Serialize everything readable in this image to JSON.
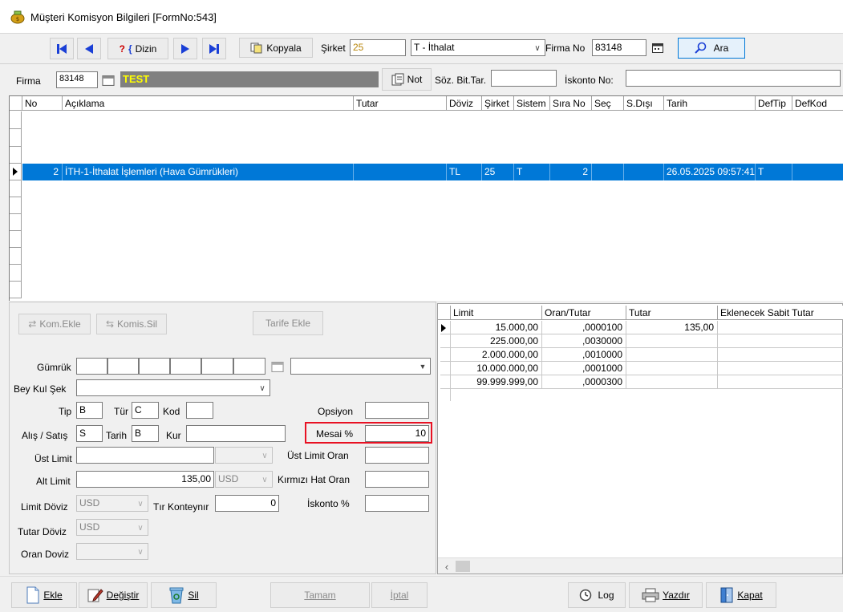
{
  "window": {
    "title": "Müşteri Komisyon Bilgileri [FormNo:543]"
  },
  "toolbar": {
    "dizin_label": "Dizin",
    "kopyala_label": "Kopyala",
    "sirket_label": "Şirket",
    "sirket_value": "25",
    "sirket_combo": "T - İthalat",
    "firma_no_label": "Firma No",
    "firma_no_value": "83148",
    "ara_label": "Ara"
  },
  "firma_bar": {
    "firma_label": "Firma",
    "firma_code": "83148",
    "firma_name": "TEST",
    "not_label": "Not",
    "soz_bit_label": "Söz. Bit.Tar.",
    "iskonto_label": "İskonto No:"
  },
  "main_grid": {
    "headers": [
      "No",
      "Açıklama",
      "Tutar",
      "Döviz",
      "Şirket",
      "Sistem",
      "Sıra No",
      "Seç",
      "S.Dışı",
      "Tarih",
      "DefTip",
      "DefKod"
    ],
    "selected_row": {
      "no": "2",
      "aciklama": "İTH-1-İthalat İşlemleri  (Hava Gümrükleri)",
      "tutar": "",
      "doviz": "TL",
      "sirket": "25",
      "sistem": "T",
      "sira_no": "2",
      "sec": "",
      "s_disi": "",
      "tarih": "26.05.2025 09:57:41",
      "deftip": "T",
      "defkod": ""
    }
  },
  "detail": {
    "kom_ekle": "Kom.Ekle",
    "komis_sil": "Komis.Sil",
    "tarife_ekle": "Tarife Ekle",
    "gumruk_label": "Gümrük",
    "bey_kul_sek_label": "Bey Kul Şek",
    "tip_label": "Tip",
    "tip_value": "B",
    "tur_label": "Tür",
    "tur_value": "C",
    "kod_label": "Kod",
    "opsiyon_label": "Opsiyon",
    "alis_satis_label": "Alış / Satış",
    "alis_satis_value": "S",
    "tarih_label": "Tarih",
    "tarih_value": "B",
    "kur_label": "Kur",
    "mesai_label": "Mesai %",
    "mesai_value": "10",
    "ust_limit_label": "Üst Limit",
    "ust_limit_oran_label": "Üst Limit Oran",
    "alt_limit_label": "Alt Limit",
    "alt_limit_value": "135,00",
    "alt_limit_doviz": "USD",
    "kirmizi_hat_label": "Kırmızı Hat Oran",
    "limit_doviz_label": "Limit Döviz",
    "limit_doviz_value": "USD",
    "tir_konteynir_label": "Tır Konteynır",
    "tir_konteynir_value": "0",
    "iskonto_pct_label": "İskonto %",
    "tutar_doviz_label": "Tutar Döviz",
    "tutar_doviz_value": "USD",
    "oran_doviz_label": "Oran Doviz"
  },
  "limit_grid": {
    "headers": [
      "Limit",
      "Oran/Tutar",
      "Tutar",
      "Eklenecek Sabit Tutar"
    ],
    "rows": [
      {
        "limit": "15.000,00",
        "oran": ",0000100",
        "tutar": "135,00"
      },
      {
        "limit": "225.000,00",
        "oran": ",0030000",
        "tutar": ""
      },
      {
        "limit": "2.000.000,00",
        "oran": ",0010000",
        "tutar": ""
      },
      {
        "limit": "10.000.000,00",
        "oran": ",0001000",
        "tutar": ""
      },
      {
        "limit": "99.999.999,00",
        "oran": ",0000300",
        "tutar": ""
      }
    ]
  },
  "bottom": {
    "ekle": "Ekle",
    "degistir": "Değiştir",
    "sil": "Sil",
    "tamam": "Tamam",
    "iptal": "İptal",
    "log": "Log",
    "yazdir": "Yazdır",
    "kapat": "Kapat"
  },
  "colors": {
    "selection": "#0078d7",
    "highlight_border": "#e81123",
    "firma_name_bg": "#808080",
    "firma_name_fg": "#ffff00"
  }
}
